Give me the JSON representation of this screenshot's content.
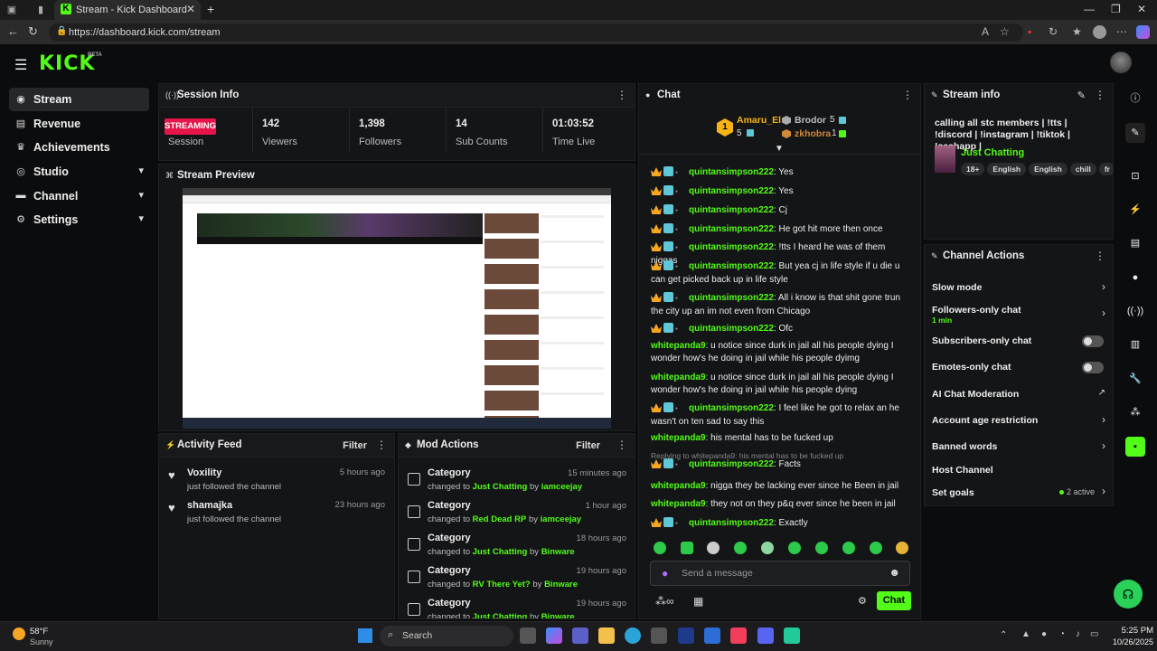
{
  "browser": {
    "tab_title": "Stream - Kick Dashboard",
    "url": "https://dashboard.kick.com/stream"
  },
  "app": {
    "logo": "KICK",
    "logo_badge": "BETA"
  },
  "sidebar": {
    "items": [
      {
        "label": "Stream",
        "icon": "broadcast-icon"
      },
      {
        "label": "Revenue",
        "icon": "revenue-icon"
      },
      {
        "label": "Achievements",
        "icon": "trophy-icon"
      },
      {
        "label": "Studio",
        "icon": "studio-icon"
      },
      {
        "label": "Channel",
        "icon": "channel-icon"
      },
      {
        "label": "Settings",
        "icon": "gear-icon"
      }
    ]
  },
  "session": {
    "title": "Session Info",
    "status_badge": "STREAMING",
    "status_label": "Session",
    "stats": [
      {
        "value": "142",
        "label": "Viewers"
      },
      {
        "value": "1,398",
        "label": "Followers"
      },
      {
        "value": "14",
        "label": "Sub Counts"
      },
      {
        "value": "01:03:52",
        "label": "Time Live"
      }
    ]
  },
  "preview": {
    "title": "Stream Preview"
  },
  "activity": {
    "title": "Activity Feed",
    "filter": "Filter",
    "items": [
      {
        "name": "Voxility",
        "desc": "just followed the channel",
        "time": "5 hours ago"
      },
      {
        "name": "shamajka",
        "desc": "just followed the channel",
        "time": "23 hours ago"
      }
    ]
  },
  "mod_actions": {
    "title": "Mod Actions",
    "filter": "Filter",
    "items": [
      {
        "title": "Category",
        "prefix": "changed to",
        "target": "Just Chatting",
        "by": "by",
        "user": "iamceejay",
        "time": "15 minutes ago"
      },
      {
        "title": "Category",
        "prefix": "changed to",
        "target": "Red Dead RP",
        "by": "by",
        "user": "iamceejay",
        "time": "1 hour ago"
      },
      {
        "title": "Category",
        "prefix": "changed to",
        "target": "Just Chatting",
        "by": "by",
        "user": "Binware",
        "time": "18 hours ago"
      },
      {
        "title": "Category",
        "prefix": "changed to",
        "target": "RV There Yet?",
        "by": "by",
        "user": "Binware",
        "time": "19 hours ago"
      },
      {
        "title": "Category",
        "prefix": "changed to",
        "target": "Just Chatting",
        "by": "by",
        "user": "Binware",
        "time": "19 hours ago"
      }
    ]
  },
  "chat": {
    "title": "Chat",
    "top_gifters": [
      {
        "name": "Amaru_El",
        "count": "5",
        "rank": "1"
      },
      {
        "name": "Brodor",
        "count": "5"
      },
      {
        "name": "zkhobra",
        "count": "1"
      }
    ],
    "messages": [
      {
        "user": "quintansimpson222",
        "text": "Yes",
        "badges": true
      },
      {
        "user": "quintansimpson222",
        "text": "Yes",
        "badges": true
      },
      {
        "user": "quintansimpson222",
        "text": "Cj",
        "badges": true
      },
      {
        "user": "quintansimpson222",
        "text": "He got hit more then once",
        "badges": true
      },
      {
        "user": "quintansimpson222",
        "text": "!tts I heard he was of them niggas",
        "badges": true
      },
      {
        "user": "quintansimpson222",
        "text": "But yea cj in life style if u die u can get picked back up in life style",
        "badges": true
      },
      {
        "user": "quintansimpson222",
        "text": "All i know is that shit gone trun the city up an im not even from Chicago",
        "badges": true
      },
      {
        "user": "quintansimpson222",
        "text": "Ofc",
        "badges": true
      },
      {
        "user": "whitepanda9",
        "text": "u notice since durk in jail all his people dying I wonder how's he doing in jail while his people dyimg",
        "badges": false
      },
      {
        "user": "whitepanda9",
        "text": "u notice since durk in jail all his people dying I wonder how's he doing in jail while his people dying",
        "badges": false
      },
      {
        "user": "quintansimpson222",
        "text": "I feel like he got to relax an he wasn't on ten sad to say this",
        "badges": true
      },
      {
        "user": "whitepanda9",
        "text": "his mental has to be fucked up",
        "badges": false
      },
      {
        "user": "quintansimpson222",
        "text": "Facts",
        "badges": true
      },
      {
        "user": "whitepanda9",
        "text": "nigga they be lacking ever since he Been in jail",
        "badges": false
      },
      {
        "user": "whitepanda9",
        "text": "they not on they p&q ever since he been in jail",
        "badges": false
      },
      {
        "user": "quintansimpson222",
        "text": "Exactly",
        "badges": true
      }
    ],
    "reply_note": "Replying to whitepanda9: his mental has to be fucked up",
    "input_placeholder": "Send a message",
    "send_label": "Chat"
  },
  "stream_info": {
    "title": "Stream info",
    "stream_title": "calling all stc members | !tts | !discord | !instagram | !tiktok | !cashapp |",
    "category": "Just Chatting",
    "tags": [
      "18+",
      "English",
      "English",
      "chill",
      "fr"
    ]
  },
  "channel_actions": {
    "title": "Channel Actions",
    "rows": [
      {
        "label": "Slow mode",
        "control": "chevron"
      },
      {
        "label": "Followers-only chat",
        "sub": "1 min",
        "control": "chevron"
      },
      {
        "label": "Subscribers-only chat",
        "control": "toggle"
      },
      {
        "label": "Emotes-only chat",
        "control": "toggle"
      },
      {
        "label": "AI Chat Moderation",
        "control": "external"
      },
      {
        "label": "Account age restriction",
        "control": "chevron"
      },
      {
        "label": "Banned words",
        "control": "chevron"
      },
      {
        "label": "Host Channel",
        "control": "none"
      },
      {
        "label": "Set goals",
        "status": "2 active",
        "control": "chevron"
      }
    ]
  },
  "taskbar": {
    "weather_temp": "58°F",
    "weather_desc": "Sunny",
    "search": "Search",
    "time": "5:25 PM",
    "date": "10/26/2025"
  },
  "colors": {
    "accent": "#53fc18",
    "streaming": "#e5154b",
    "background": "#0b0c0d"
  }
}
